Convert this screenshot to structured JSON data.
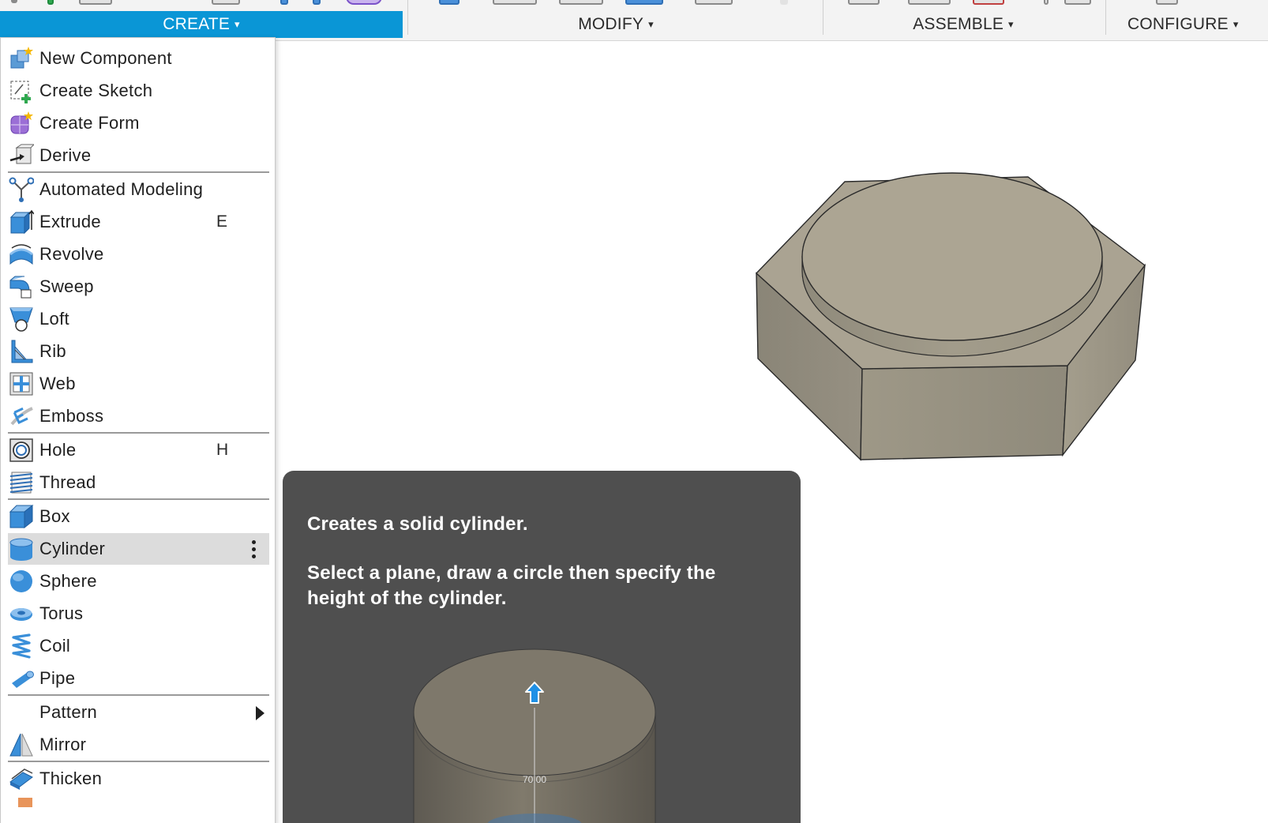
{
  "toolbar": {
    "tabs": [
      {
        "label": "CREATE",
        "active": true
      },
      {
        "label": "MODIFY",
        "active": false
      },
      {
        "label": "ASSEMBLE",
        "active": false
      },
      {
        "label": "CONFIGURE",
        "active": false
      }
    ],
    "caret": "▾"
  },
  "menu": {
    "items": [
      {
        "label": "New Component",
        "icon": "new-component-icon"
      },
      {
        "label": "Create Sketch",
        "icon": "create-sketch-icon"
      },
      {
        "label": "Create Form",
        "icon": "create-form-icon"
      },
      {
        "label": "Derive",
        "icon": "derive-icon"
      },
      {
        "label": "Automated Modeling",
        "icon": "automated-modeling-icon"
      },
      {
        "label": "Extrude",
        "icon": "extrude-icon",
        "shortcut": "E"
      },
      {
        "label": "Revolve",
        "icon": "revolve-icon"
      },
      {
        "label": "Sweep",
        "icon": "sweep-icon"
      },
      {
        "label": "Loft",
        "icon": "loft-icon"
      },
      {
        "label": "Rib",
        "icon": "rib-icon"
      },
      {
        "label": "Web",
        "icon": "web-icon"
      },
      {
        "label": "Emboss",
        "icon": "emboss-icon"
      },
      {
        "label": "Hole",
        "icon": "hole-icon",
        "shortcut": "H"
      },
      {
        "label": "Thread",
        "icon": "thread-icon"
      },
      {
        "label": "Box",
        "icon": "box-icon"
      },
      {
        "label": "Cylinder",
        "icon": "cylinder-icon",
        "selected": true
      },
      {
        "label": "Sphere",
        "icon": "sphere-icon"
      },
      {
        "label": "Torus",
        "icon": "torus-icon"
      },
      {
        "label": "Coil",
        "icon": "coil-icon"
      },
      {
        "label": "Pipe",
        "icon": "pipe-icon"
      },
      {
        "label": "Pattern",
        "icon": "",
        "submenu": true
      },
      {
        "label": "Mirror",
        "icon": "mirror-icon"
      },
      {
        "label": "Thicken",
        "icon": "thicken-icon"
      }
    ]
  },
  "tooltip": {
    "title": "Creates a solid cylinder.",
    "description": "Select a plane, draw a circle then specify the height of the cylinder.",
    "dimension_label": "70.00"
  },
  "colors": {
    "accent": "#0a96d6",
    "menu_selected": "#dcdcdc",
    "tooltip_bg": "#4f4f4f",
    "model_face": "#aca593"
  }
}
